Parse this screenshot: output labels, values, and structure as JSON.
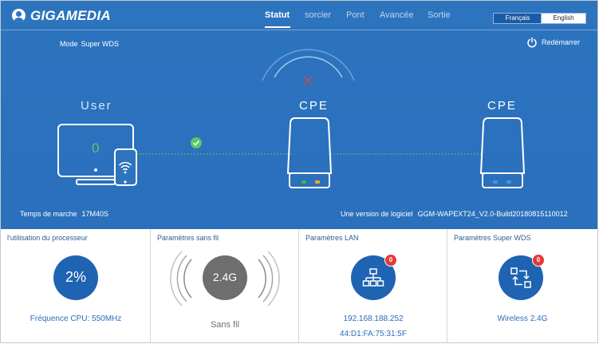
{
  "brand": {
    "name": "GIGAMEDIA"
  },
  "nav": {
    "items": [
      "Statut",
      "sorcier",
      "Pont",
      "Avancée",
      "Sortie"
    ],
    "active": "Statut"
  },
  "language": {
    "french": "Français",
    "english": "English"
  },
  "status": {
    "mode_label": "Mode",
    "mode_value": "Super WDS",
    "restart_label": "Redémarrer",
    "user_label": "User",
    "user_count": "0",
    "cpe_label_1": "CPE",
    "cpe_label_2": "CPE",
    "uptime_label": "Temps de marche",
    "uptime_value": "17M40S",
    "version_label": "Une version de logiciel",
    "version_value": "GGM-WAPEXT24_V2.0-Build20180815110012"
  },
  "panels": {
    "cpu": {
      "title": "l'utilisation du processeur",
      "value": "2%",
      "frequency": "Fréquence CPU: 550MHz"
    },
    "wireless": {
      "title": "Paramètres sans fil",
      "band": "2.4G",
      "label": "Sans fil"
    },
    "lan": {
      "title": "Paramètres LAN",
      "badge": "0",
      "ip": "192.168.188.252",
      "mac": "44:D1:FA:75:31:5F"
    },
    "wds": {
      "title": "Paramètres Super WDS",
      "badge": "0",
      "label": "Wireless 2.4G"
    }
  },
  "icons": [
    "user-icon",
    "power-icon",
    "monitor-icon",
    "phone-icon",
    "wifi-icon",
    "check-icon",
    "signal-arcs-icon",
    "disconnected-x-icon",
    "cpe-device-icon",
    "network-tree-icon",
    "wds-arrows-icon"
  ],
  "colors": {
    "header_bg": "#2d74bf",
    "accent": "#2b6db8",
    "circle_blue": "#1f63b3",
    "badge_red": "#e53935",
    "link_ok": "#5cc66b",
    "led_green": "#3bb54a",
    "led_orange": "#f5a623",
    "gray_circle": "#6e6e6e"
  }
}
